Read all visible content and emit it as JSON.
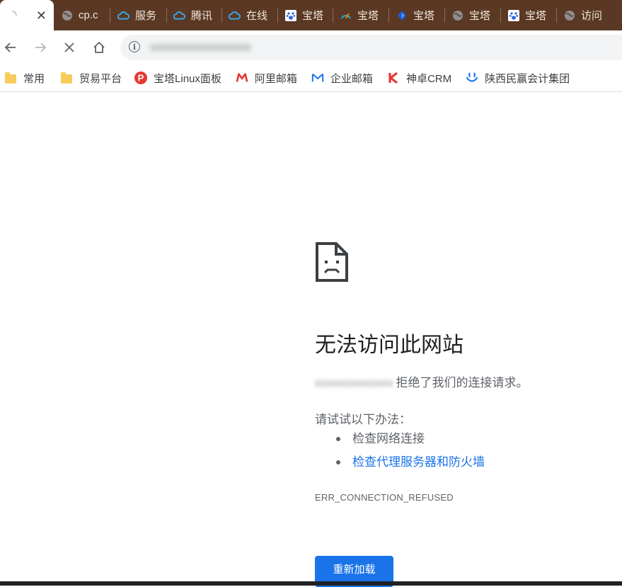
{
  "tabs": [
    {
      "title": "",
      "favicon": "loading-icon",
      "active": true,
      "close_label": "✕"
    },
    {
      "title": "cp.c",
      "favicon": "globe-icon"
    },
    {
      "title": "服务",
      "favicon": "cloud-icon"
    },
    {
      "title": "腾讯",
      "favicon": "cloud-icon"
    },
    {
      "title": "在线",
      "favicon": "cloud-icon"
    },
    {
      "title": "宝塔",
      "favicon": "baidu-paw-icon"
    },
    {
      "title": "宝塔",
      "favicon": "speedometer-icon"
    },
    {
      "title": "宝塔",
      "favicon": "diamond-icon"
    },
    {
      "title": "宝塔",
      "favicon": "globe-icon"
    },
    {
      "title": "宝塔",
      "favicon": "baidu-paw-icon"
    },
    {
      "title": "访问",
      "favicon": "globe-icon"
    }
  ],
  "toolbar": {
    "url": "xxxxxxxxxxxxxxxxxxx"
  },
  "bookmarks": [
    {
      "label": "常用",
      "icon": "folder-icon"
    },
    {
      "label": "贸易平台",
      "icon": "folder-icon"
    },
    {
      "label": "宝塔Linux面板",
      "icon": "bt-panel-icon",
      "color": "#e53935"
    },
    {
      "label": "阿里邮箱",
      "icon": "ali-mail-icon",
      "color": "#e53935"
    },
    {
      "label": "企业邮箱",
      "icon": "enterprise-mail-icon",
      "color": "#1a73e8"
    },
    {
      "label": "神卓CRM",
      "icon": "crm-k-icon",
      "color": "#e53935"
    },
    {
      "label": "陕西民赢会计集团",
      "icon": "smile-icon",
      "color": "#1a73e8"
    }
  ],
  "error": {
    "icon": "sad-document-icon",
    "title": "无法访问此网站",
    "host": "xxxxxxxxxxxxx",
    "refused_text": "拒绝了我们的连接请求。",
    "try_label": "请试试以下办法：",
    "suggestions": [
      {
        "text": "检查网络连接",
        "link": false
      },
      {
        "text": "检查代理服务器和防火墙",
        "link": true
      }
    ],
    "code": "ERR_CONNECTION_REFUSED",
    "reload_label": "重新加载"
  },
  "colors": {
    "tabstrip": "#5a3823",
    "accent": "#1a73e8",
    "text_secondary": "#5f6368"
  }
}
